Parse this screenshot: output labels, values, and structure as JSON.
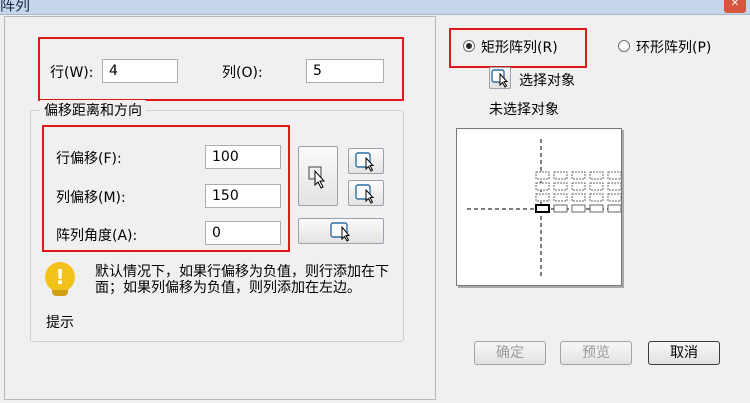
{
  "window": {
    "title": "阵列"
  },
  "rows": {
    "label": "行(W):",
    "value": "4"
  },
  "cols": {
    "label": "列(O):",
    "value": "5"
  },
  "offset_group": {
    "title": "偏移距离和方向"
  },
  "row_offset": {
    "label": "行偏移(F):",
    "value": "100"
  },
  "col_offset": {
    "label": "列偏移(M):",
    "value": "150"
  },
  "array_angle": {
    "label": "阵列角度(A):",
    "value": "0"
  },
  "hint": {
    "caption": "提示",
    "text": "默认情况下，如果行偏移为负值，则行添加在下面；如果列偏移为负值，则列添加在左边。"
  },
  "array_type": {
    "rect_label": "矩形阵列(R)",
    "polar_label": "环形阵列(P)",
    "selected": "rect"
  },
  "select_objects": {
    "label": "选择对象",
    "status": "未选择对象"
  },
  "buttons": {
    "ok": "确定",
    "preview": "预览",
    "cancel": "取消"
  },
  "colors": {
    "highlight": "#e01818"
  }
}
